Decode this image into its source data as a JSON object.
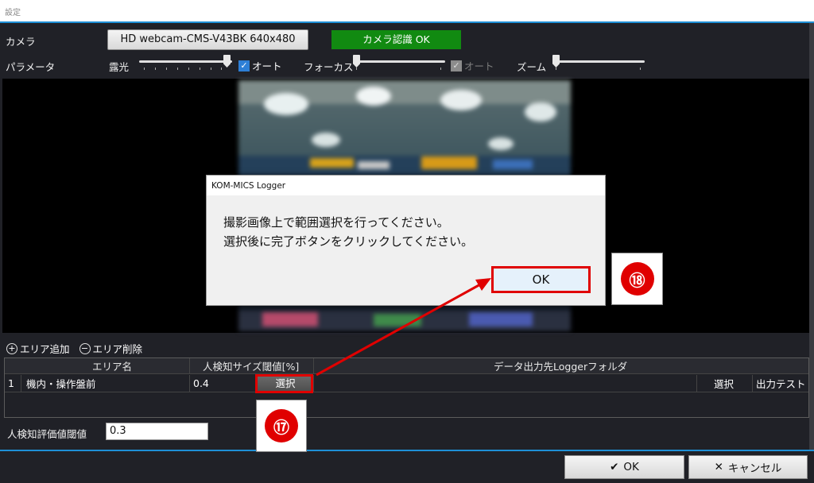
{
  "window": {
    "title": "設定"
  },
  "camera": {
    "label": "カメラ",
    "device": "HD webcam-CMS-V43BK  640x480",
    "status": "カメラ認識 OK",
    "status_color": "#118a11"
  },
  "params": {
    "label": "パラメータ",
    "exposure": {
      "label": "露光",
      "value": 1.0,
      "auto_checked": true,
      "auto_label": "オート"
    },
    "focus": {
      "label": "フォーカス",
      "value": 0.0,
      "auto_checked": true,
      "auto_enabled": false,
      "auto_label": "オート"
    },
    "zoom": {
      "label": "ズーム",
      "value": 0.0
    }
  },
  "area_tools": {
    "add": "エリア追加",
    "remove": "エリア削除"
  },
  "grid": {
    "headers": {
      "name": "エリア名",
      "threshold": "人検知サイズ閾値[%]",
      "folder": "データ出力先Loggerフォルダ"
    },
    "rows": [
      {
        "index": "1",
        "name": "機内・操作盤前",
        "threshold": "0.4",
        "select_area": "選択",
        "select_folder": "選択",
        "output_test": "出力テスト"
      }
    ]
  },
  "eval_threshold": {
    "label": "人検知評価値閾値",
    "value": "0.3"
  },
  "footer": {
    "ok": "OK",
    "cancel": "キャンセル"
  },
  "dialog": {
    "title": "KOM-MICS Logger",
    "line1": "撮影画像上で範囲選択を行ってください。",
    "line2": "選択後に完了ボタンをクリックしてください。",
    "ok": "OK"
  },
  "annotations": {
    "step17": "⑰",
    "step18": "⑱",
    "color": "#e00000"
  }
}
